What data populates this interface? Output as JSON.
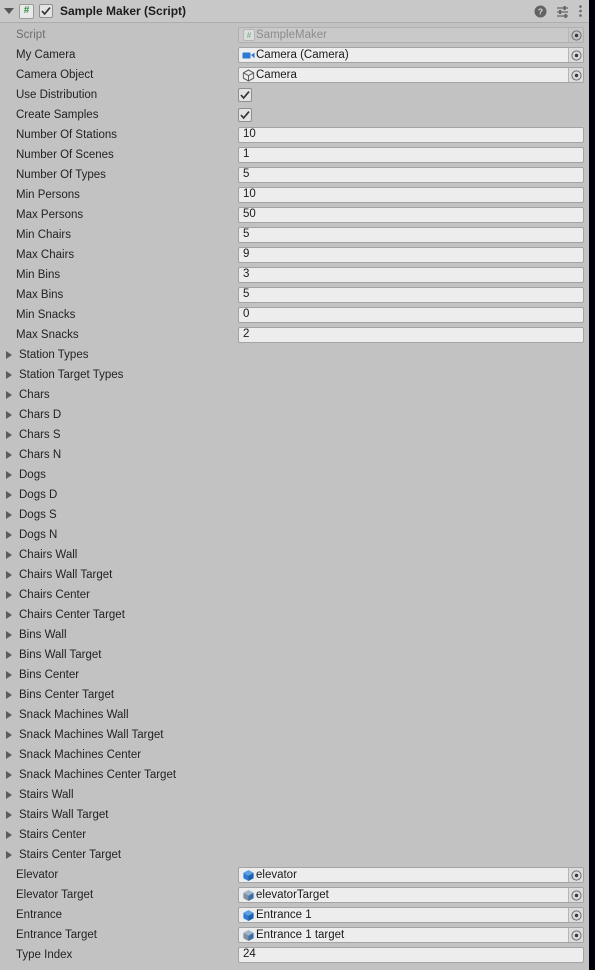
{
  "window": {
    "background_color": "#c2c2c2",
    "field_color": "#ededed",
    "accent_blue": "#2f79d0"
  },
  "header": {
    "title": "Sample Maker (Script)",
    "foldout_icon": "triangle-down-icon",
    "script_badge": "#",
    "enabled_checkbox": true,
    "help_icon": "help-icon",
    "preset_icon": "preset-icon",
    "menu_icon": "kebab-menu-icon"
  },
  "properties": [
    {
      "kind": "object",
      "label": "Script",
      "value": "SampleMaker",
      "icon": "script-icon",
      "disabled": true
    },
    {
      "kind": "object",
      "label": "My Camera",
      "value": "Camera (Camera)",
      "icon": "camera-icon",
      "disabled": false
    },
    {
      "kind": "object",
      "label": "Camera Object",
      "value": "Camera",
      "icon": "gameobject-icon",
      "disabled": false
    },
    {
      "kind": "bool",
      "label": "Use Distribution",
      "value": true
    },
    {
      "kind": "bool",
      "label": "Create Samples",
      "value": true
    },
    {
      "kind": "number",
      "label": "Number Of Stations",
      "value": "10"
    },
    {
      "kind": "number",
      "label": "Number Of Scenes",
      "value": "1"
    },
    {
      "kind": "number",
      "label": "Number Of Types",
      "value": "5"
    },
    {
      "kind": "number",
      "label": "Min Persons",
      "value": "10"
    },
    {
      "kind": "number",
      "label": "Max Persons",
      "value": "50"
    },
    {
      "kind": "number",
      "label": "Min Chairs",
      "value": "5"
    },
    {
      "kind": "number",
      "label": "Max Chairs",
      "value": "9"
    },
    {
      "kind": "number",
      "label": "Min Bins",
      "value": "3"
    },
    {
      "kind": "number",
      "label": "Max Bins",
      "value": "5"
    },
    {
      "kind": "number",
      "label": "Min Snacks",
      "value": "0"
    },
    {
      "kind": "number",
      "label": "Max Snacks",
      "value": "2"
    }
  ],
  "foldouts": [
    {
      "label": "Station Types",
      "expanded": false
    },
    {
      "label": "Station Target Types",
      "expanded": false
    },
    {
      "label": "Chars",
      "expanded": false
    },
    {
      "label": "Chars D",
      "expanded": false
    },
    {
      "label": "Chars S",
      "expanded": false
    },
    {
      "label": "Chars N",
      "expanded": false
    },
    {
      "label": "Dogs",
      "expanded": false
    },
    {
      "label": "Dogs D",
      "expanded": false
    },
    {
      "label": "Dogs S",
      "expanded": false
    },
    {
      "label": "Dogs N",
      "expanded": false
    },
    {
      "label": "Chairs Wall",
      "expanded": false
    },
    {
      "label": "Chairs Wall Target",
      "expanded": false
    },
    {
      "label": "Chairs Center",
      "expanded": false
    },
    {
      "label": "Chairs Center Target",
      "expanded": false
    },
    {
      "label": "Bins Wall",
      "expanded": false
    },
    {
      "label": "Bins Wall Target",
      "expanded": false
    },
    {
      "label": "Bins Center",
      "expanded": false
    },
    {
      "label": "Bins Center Target",
      "expanded": false
    },
    {
      "label": "Snack Machines Wall",
      "expanded": false
    },
    {
      "label": "Snack Machines Wall Target",
      "expanded": false
    },
    {
      "label": "Snack Machines Center",
      "expanded": false
    },
    {
      "label": "Snack Machines Center Target",
      "expanded": false
    },
    {
      "label": "Stairs Wall",
      "expanded": false
    },
    {
      "label": "Stairs Wall Target",
      "expanded": false
    },
    {
      "label": "Stairs Center",
      "expanded": false
    },
    {
      "label": "Stairs Center Target",
      "expanded": false
    }
  ],
  "tail_properties": [
    {
      "kind": "object",
      "label": "Elevator",
      "value": "elevator",
      "icon": "prefab-icon",
      "disabled": false
    },
    {
      "kind": "object",
      "label": "Elevator Target",
      "value": "elevatorTarget",
      "icon": "prefab-grey-icon",
      "disabled": false
    },
    {
      "kind": "object",
      "label": "Entrance",
      "value": "Entrance 1",
      "icon": "prefab-icon",
      "disabled": false
    },
    {
      "kind": "object",
      "label": "Entrance Target",
      "value": "Entrance 1 target",
      "icon": "prefab-grey-icon",
      "disabled": false
    },
    {
      "kind": "number",
      "label": "Type Index",
      "value": "24"
    }
  ]
}
